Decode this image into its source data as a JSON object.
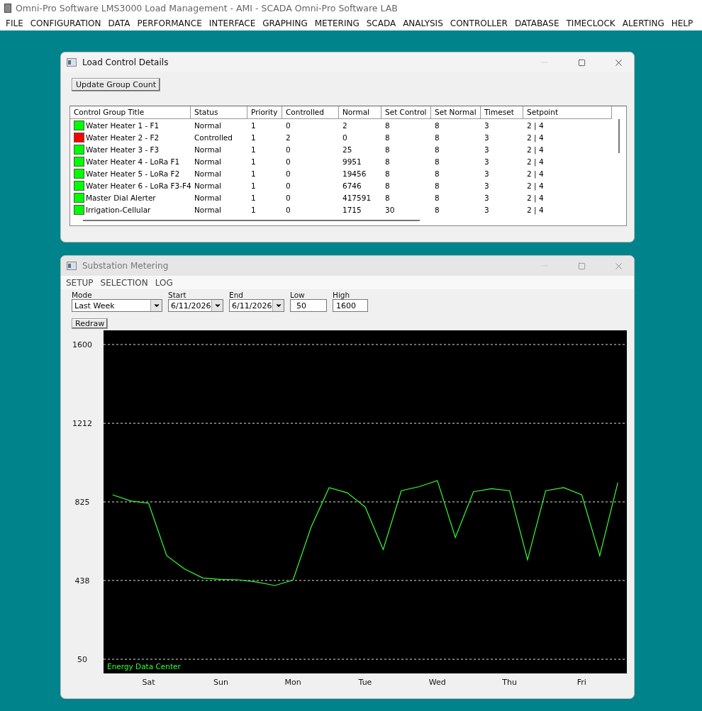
{
  "app": {
    "title": "Omni-Pro Software LMS3000 Load Management - AMI - SCADA  Omni-Pro Software LAB",
    "menu": [
      "FILE",
      "CONFIGURATION",
      "DATA",
      "PERFORMANCE",
      "INTERFACE",
      "GRAPHING",
      "METERING",
      "SCADA",
      "ANALYSIS",
      "CONTROLLER",
      "DATABASE",
      "TIMECLOCK",
      "ALERTING",
      "HELP"
    ]
  },
  "load_control": {
    "title": "Load Control Details",
    "update_button": "Update Group Count",
    "columns": [
      "Control Group Title",
      "Status",
      "Priority",
      "Controlled",
      "Normal",
      "Set Control",
      "Set Normal",
      "Timeset",
      "Setpoint"
    ],
    "rows": [
      {
        "color": "#00ff00",
        "cells": [
          "Water Heater 1 - F1",
          "Normal",
          "1",
          "0",
          "2",
          "8",
          "8",
          "3",
          "2 | 4"
        ]
      },
      {
        "color": "#ff0000",
        "cells": [
          "Water Heater 2 - F2",
          "Controlled",
          "1",
          "2",
          "0",
          "8",
          "8",
          "3",
          "2 | 4"
        ]
      },
      {
        "color": "#00ff00",
        "cells": [
          "Water Heater 3 - F3",
          "Normal",
          "1",
          "0",
          "25",
          "8",
          "8",
          "3",
          "2 | 4"
        ]
      },
      {
        "color": "#00ff00",
        "cells": [
          "Water Heater 4 - LoRa F1",
          "Normal",
          "1",
          "0",
          "9951",
          "8",
          "8",
          "3",
          "2 | 4"
        ]
      },
      {
        "color": "#00ff00",
        "cells": [
          "Water Heater 5 - LoRa F2",
          "Normal",
          "1",
          "0",
          "19456",
          "8",
          "8",
          "3",
          "2 | 4"
        ]
      },
      {
        "color": "#00ff00",
        "cells": [
          "Water Heater 6 - LoRa F3-F4",
          "Normal",
          "1",
          "0",
          "6746",
          "8",
          "8",
          "3",
          "2 | 4"
        ]
      },
      {
        "color": "#00ff00",
        "cells": [
          "Master Dial Alerter",
          "Normal",
          "1",
          "0",
          "417591",
          "8",
          "8",
          "3",
          "2 | 4"
        ]
      },
      {
        "color": "#00ff00",
        "cells": [
          "Irrigation-Cellular",
          "Normal",
          "1",
          "0",
          "1715",
          "30",
          "8",
          "3",
          "2 | 4"
        ]
      }
    ]
  },
  "substation": {
    "title": "Substation Metering",
    "menu": [
      "SETUP",
      "SELECTION",
      "LOG"
    ],
    "fields": [
      {
        "kind": "dropdown",
        "label": "Mode",
        "value": "Last Week"
      },
      {
        "kind": "dropdown",
        "label": "Start",
        "value": "6/11/2026"
      },
      {
        "kind": "dropdown",
        "label": "End",
        "value": "6/11/2026"
      },
      {
        "kind": "text",
        "label": "Low",
        "value": "50"
      },
      {
        "kind": "text",
        "label": "High",
        "value": "1600"
      }
    ],
    "redraw_button": "Redraw",
    "chart_caption": "Energy Data Center",
    "chart_data": {
      "type": "line",
      "ylim": [
        50,
        1600
      ],
      "grid": true,
      "yticks": [
        50,
        438,
        825,
        1212,
        1600
      ],
      "categories": [
        null,
        null,
        "Sat",
        null,
        null,
        null,
        "Sun",
        null,
        null,
        null,
        "Mon",
        null,
        null,
        null,
        "Tue",
        null,
        null,
        null,
        "Wed",
        null,
        null,
        null,
        "Thu",
        null,
        null,
        null,
        "Fri",
        null,
        null
      ],
      "series": [
        {
          "color": "#33ff33",
          "values": [
            860,
            830,
            818,
            560,
            494,
            450,
            443,
            441,
            430,
            413,
            440,
            700,
            895,
            870,
            800,
            590,
            880,
            900,
            930,
            650,
            875,
            890,
            880,
            540,
            880,
            895,
            860,
            560,
            920
          ]
        }
      ]
    }
  }
}
